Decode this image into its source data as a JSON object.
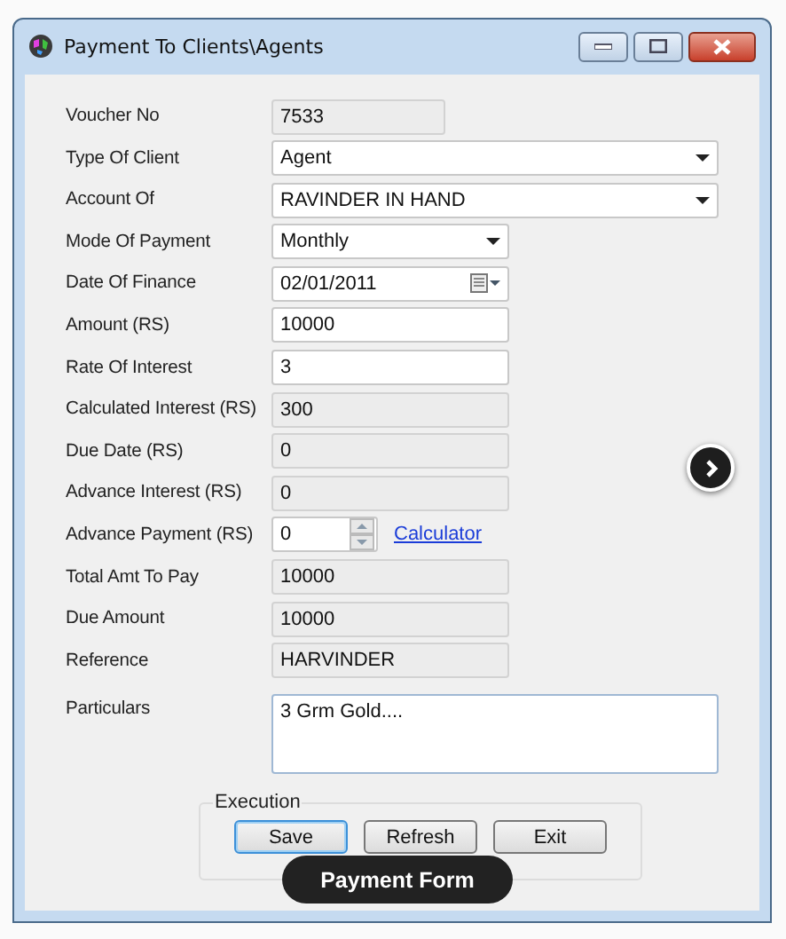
{
  "window": {
    "title": "Payment To Clients\\Agents"
  },
  "fields": [
    {
      "label": "Voucher No",
      "kind": "readonly",
      "value": "7533"
    },
    {
      "label": "Type Of Client",
      "kind": "dropdown",
      "value": "Agent"
    },
    {
      "label": "Account Of",
      "kind": "dropdown",
      "value": "RAVINDER IN HAND"
    },
    {
      "label": "Mode Of Payment",
      "kind": "dropdown",
      "value": "Monthly"
    },
    {
      "label": "Date Of Finance",
      "kind": "date",
      "value": "02/01/2011"
    },
    {
      "label": "Amount (RS)",
      "kind": "input",
      "value": "10000"
    },
    {
      "label": "Rate Of Interest",
      "kind": "input",
      "value": "3"
    },
    {
      "label": "Calculated Interest (RS)",
      "kind": "readonly",
      "value": "300"
    },
    {
      "label": "Due Date (RS)",
      "kind": "readonly",
      "value": "0"
    },
    {
      "label": "Advance Interest (RS)",
      "kind": "readonly",
      "value": "0"
    },
    {
      "label": "Advance Payment (RS)",
      "kind": "spinner",
      "value": "0",
      "link": "Calculator"
    },
    {
      "label": "Total Amt To Pay",
      "kind": "readonly",
      "value": "10000"
    },
    {
      "label": "Due Amount",
      "kind": "readonly",
      "value": "10000"
    },
    {
      "label": "Reference",
      "kind": "readonly",
      "value": "HARVINDER"
    },
    {
      "label": "Particulars",
      "kind": "textarea",
      "value": "3 Grm Gold...."
    }
  ],
  "execution": {
    "title": "Execution",
    "buttons": [
      {
        "label": "Save",
        "default": true
      },
      {
        "label": "Refresh",
        "default": false
      },
      {
        "label": "Exit",
        "default": false
      }
    ]
  },
  "caption": "Payment Form"
}
